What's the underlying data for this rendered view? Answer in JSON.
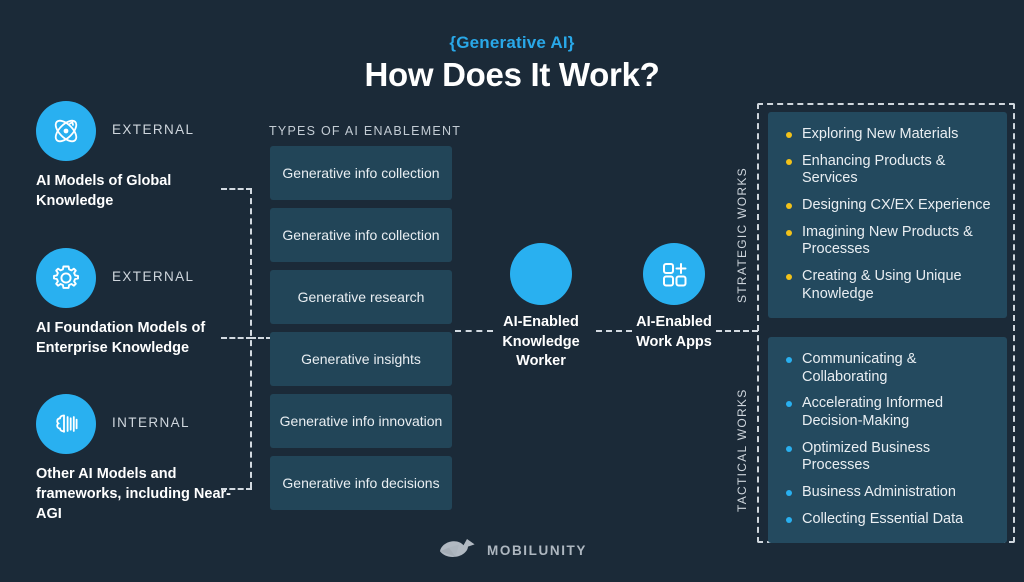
{
  "header": {
    "eyebrow": "{Generative AI}",
    "title": "How Does It Work?"
  },
  "colors": {
    "background": "#1b2a38",
    "accent_blue": "#29b0f0",
    "eyebrow_blue": "#29a8e8",
    "box_slate": "#224558",
    "panel_slate": "#23495e",
    "bullet_yellow": "#f2c21a",
    "bullet_blue": "#29b0f0",
    "dashed_line": "#d3dae1"
  },
  "sources": {
    "items": [
      {
        "kind": "EXTERNAL",
        "title": "AI  Models of Global Knowledge",
        "icon": "atom-icon"
      },
      {
        "kind": "EXTERNAL",
        "title": "AI Foundation Models of Enterprise Knowledge",
        "icon": "gear-icon"
      },
      {
        "kind": "INTERNAL",
        "title": "Other AI Models and frameworks, including Near-AGI",
        "icon": "brain-icon"
      }
    ]
  },
  "enablement": {
    "heading": "TYPES OF AI ENABLEMENT",
    "items": [
      "Generative info collection",
      "Generative info collection",
      "Generative research",
      "Generative insights",
      "Generative info innovation",
      "Generative info decisions"
    ]
  },
  "nodes": [
    {
      "label": "AI-Enabled Knowledge Worker",
      "icon": "solid-circle-icon"
    },
    {
      "label": "AI-Enabled Work Apps",
      "icon": "apps-grid-plus-icon"
    }
  ],
  "outcomes": {
    "strategic": {
      "axis_label": "STRATEGIC WORKS",
      "bullet_color": "#f2c21a",
      "items": [
        "Exploring New Materials",
        "Enhancing Products & Services",
        "Designing CX/EX Experience",
        "Imagining New Products & Processes",
        "Creating & Using Unique Knowledge"
      ]
    },
    "tactical": {
      "axis_label": "TACTICAL WORKS",
      "bullet_color": "#29b0f0",
      "items": [
        "Communicating & Collaborating",
        "Accelerating Informed Decision-Making",
        "Optimized Business Processes",
        "Business Administration",
        "Collecting Essential Data"
      ]
    }
  },
  "footer": {
    "brand": "MOBILUNITY",
    "logo": "whale-logo-icon"
  }
}
